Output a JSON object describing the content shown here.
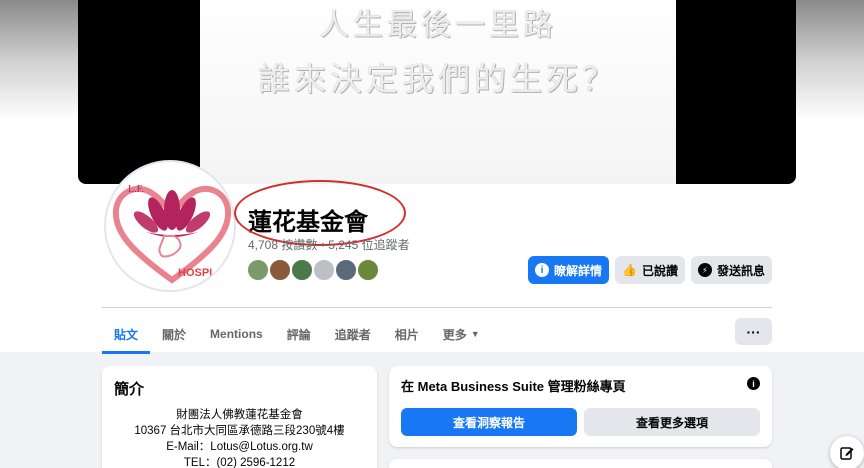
{
  "cover": {
    "line1": "人生最後一里路",
    "line2": "誰來決定我們的生死？"
  },
  "avatar": {
    "logo_top": "L.F.",
    "logo_bottom": "HOSPI"
  },
  "page": {
    "name": "蓮花基金會",
    "stats": "4,708 按讚數 • 5,245 位追蹤者"
  },
  "actions": {
    "learn_more": "瞭解詳情",
    "liked": "已說讚",
    "message": "發送訊息"
  },
  "tabs": [
    {
      "label": "貼文"
    },
    {
      "label": "關於"
    },
    {
      "label": "Mentions"
    },
    {
      "label": "評論"
    },
    {
      "label": "追蹤者"
    },
    {
      "label": "相片"
    },
    {
      "label": "更多"
    }
  ],
  "more_button": "···",
  "intro": {
    "title": "簡介",
    "lines": [
      "財團法人佛教蓮花基金會",
      "10367 台北市大同區承德路三段230號4樓",
      "E-Mail：Lotus@Lotus.org.tw",
      "TEL：(02) 2596-1212"
    ]
  },
  "meta": {
    "title": "在 Meta Business Suite 管理粉絲專頁",
    "insights_button": "查看洞察報告",
    "more_options_button": "查看更多選項"
  },
  "colors": {
    "accent": "#1877f2",
    "highlight_circle": "#d32f2f",
    "lotus": "#b3245e"
  }
}
